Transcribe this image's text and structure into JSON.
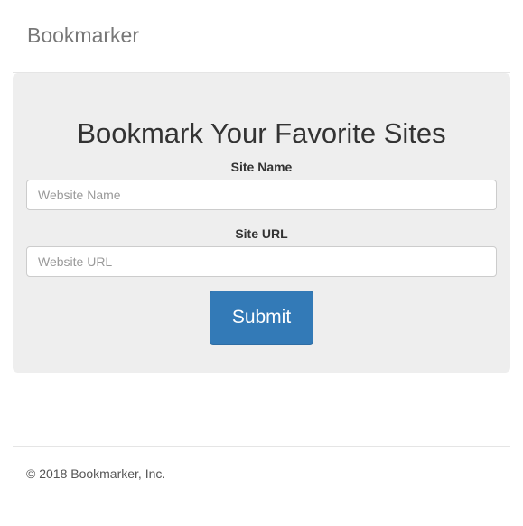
{
  "header": {
    "brand": "Bookmarker"
  },
  "form": {
    "title": "Bookmark Your Favorite Sites",
    "site_name_label": "Site Name",
    "site_name_placeholder": "Website Name",
    "site_name_value": "",
    "site_url_label": "Site URL",
    "site_url_placeholder": "Website URL",
    "site_url_value": "",
    "submit_label": "Submit"
  },
  "footer": {
    "copyright": "© 2018 Bookmarker, Inc."
  },
  "colors": {
    "primary": "#337ab7",
    "jumbotron_bg": "#eeeeee",
    "brand_text": "#777777"
  }
}
